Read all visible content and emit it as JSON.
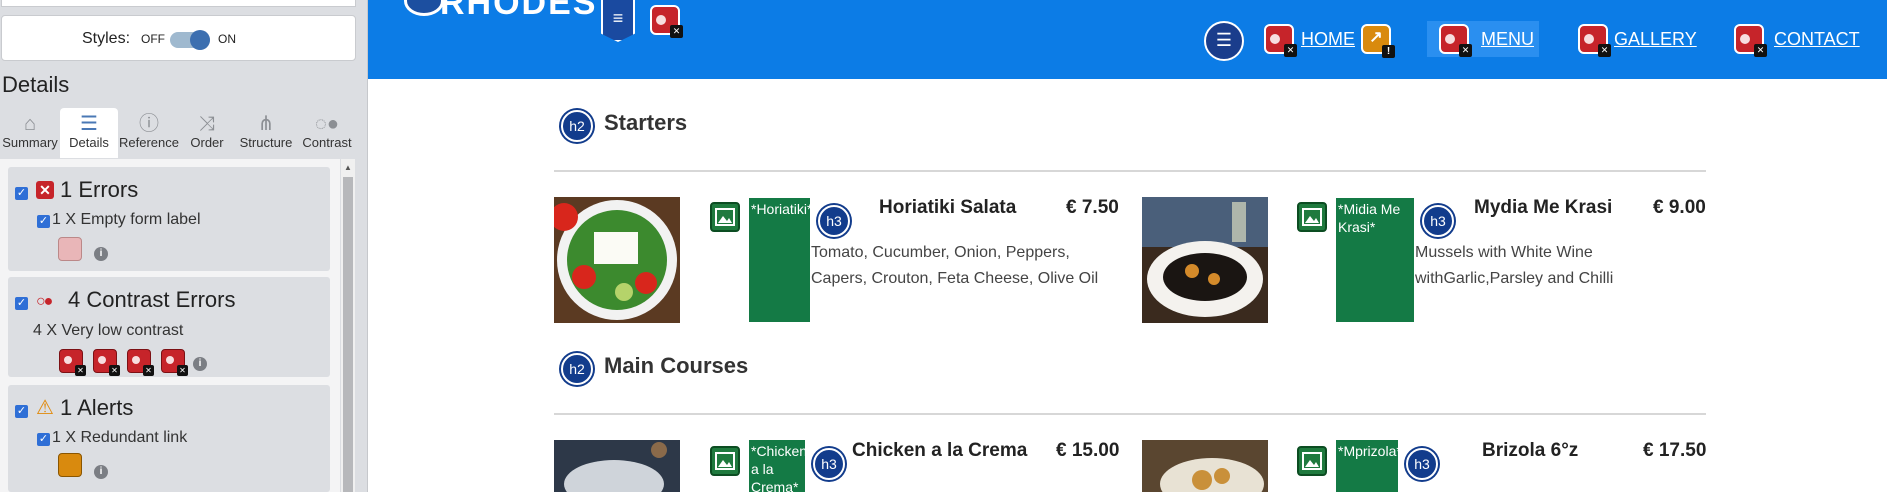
{
  "panel": {
    "styles_label": "Styles:",
    "toggle_off": "OFF",
    "toggle_on": "ON",
    "details_title": "Details",
    "tabs": [
      {
        "label": "Summary",
        "icon": "home-icon"
      },
      {
        "label": "Details",
        "icon": "list-icon"
      },
      {
        "label": "Reference",
        "icon": "info-icon"
      },
      {
        "label": "Order",
        "icon": "order-icon"
      },
      {
        "label": "Structure",
        "icon": "structure-icon"
      },
      {
        "label": "Contrast",
        "icon": "contrast-icon"
      }
    ],
    "groups": {
      "errors": {
        "title": "1 Errors",
        "item": "1 X Empty form label"
      },
      "contrast": {
        "title": "4 Contrast Errors",
        "item": "4 X Very low contrast"
      },
      "alerts": {
        "title": "1 Alerts",
        "item": "1 X Redundant link"
      }
    },
    "info_glyph": "i"
  },
  "site": {
    "logo": "RHODES",
    "badge_h2": "h2",
    "badge_h3": "h3",
    "nav": [
      "HOME",
      "MENU",
      "GALLERY",
      "CONTACT"
    ],
    "sections": [
      {
        "title": "Starters"
      },
      {
        "title": "Main Courses"
      }
    ],
    "dishes": [
      {
        "alt": "*Horiatiki*",
        "name": "Horiatiki Salata",
        "price": "€ 7.50",
        "desc": "Tomato, Cucumber, Onion, Peppers, Capers, Crouton, Feta Cheese, Olive Oil"
      },
      {
        "alt": "*Midia Me Krasi*",
        "name": "Mydia Me Krasi",
        "price": "€ 9.00",
        "desc": "Mussels with White Wine withGarlic,Parsley and Chilli"
      },
      {
        "alt": "*Chicken a la Crema*",
        "name": "Chicken a la Crema",
        "price": "€ 15.00",
        "desc": ""
      },
      {
        "alt": "*Mprizola*",
        "name": "Brizola 6°z",
        "price": "€ 17.50",
        "desc": ""
      }
    ]
  },
  "colors": {
    "header_blue": "#0c7ce6",
    "error_red": "#c6242a",
    "alt_green": "#147a45",
    "badge_navy": "#123c8c"
  }
}
